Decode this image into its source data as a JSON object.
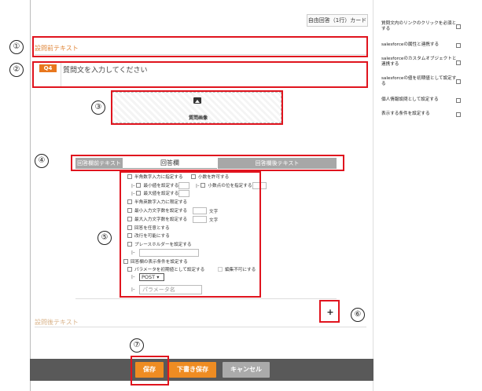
{
  "header": {
    "type_badge": "自由回答（1行）カード"
  },
  "annotations": [
    "①",
    "②",
    "③",
    "④",
    "⑤",
    "⑥",
    "⑦"
  ],
  "question": {
    "pre_text_placeholder": "設問前テキスト",
    "number_badge": "Q4",
    "text_placeholder": "質問文を入力してください",
    "image_label": "質問画像",
    "post_text_placeholder": "設問後テキスト"
  },
  "answer": {
    "before_label": "回答欄前テキスト",
    "field_label": "回答欄",
    "after_label": "回答欄後テキスト"
  },
  "options": {
    "halfwidth_number": "半角数字入力に指定する",
    "allow_decimal": "小数を許可する",
    "min_value": "最小値を設定する",
    "decimal_places": "小数点の位を指定する",
    "max_value": "最大値を設定する",
    "halfwidth_alnum": "半角英数字入力に限定する",
    "min_chars": "最小入力文字数を設定する",
    "max_chars": "最大入力文字数を設定する",
    "chars_unit": "文字",
    "optional": "回答を任意とする",
    "allow_newline": "改行を可能にする",
    "placeholder": "プレースホルダーを設定する",
    "answer_display_condition": "回答欄の表示条件を設定する",
    "param_initial": "パラメータを初期値として設定する",
    "not_editable": "編集不可にする",
    "method_value": "POST",
    "param_name_placeholder": "パラメータ名",
    "indent_marker": "|–"
  },
  "actions": {
    "add": "+",
    "save": "保存",
    "draft_save": "下書き保存",
    "cancel": "キャンセル"
  },
  "settings_panel": {
    "items": [
      "質問文内のリンクのクリックを必須とする",
      "salesforceの属性と連携する",
      "salesforceのカスタムオブジェクトと連携する",
      "salesforceの値を初期値として設定する",
      "個人情報設問として設定する",
      "表示する条件を設定する"
    ]
  },
  "colors": {
    "annotation_red": "#e0141e",
    "accent_orange": "#ee8c22",
    "bottom_bar": "#595959",
    "gray_label": "#a7a7a7"
  }
}
